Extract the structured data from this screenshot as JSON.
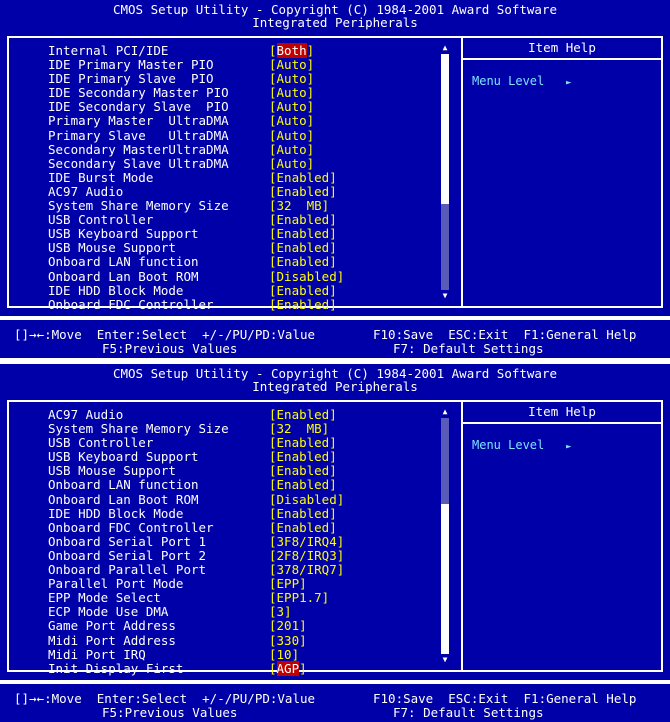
{
  "screens": [
    {
      "title_line1": "CMOS Setup Utility - Copyright (C) 1984-2001 Award Software",
      "title_line2": "Integrated Peripherals",
      "help_title": "Item Help",
      "menu_level": "Menu Level",
      "rows": [
        {
          "label": "Internal PCI/IDE",
          "value": "[Both]",
          "selected": true
        },
        {
          "label": "IDE Primary Master PIO",
          "value": "[Auto]"
        },
        {
          "label": "IDE Primary Slave  PIO",
          "value": "[Auto]"
        },
        {
          "label": "IDE Secondary Master PIO",
          "value": "[Auto]"
        },
        {
          "label": "IDE Secondary Slave  PIO",
          "value": "[Auto]"
        },
        {
          "label": "Primary Master  UltraDMA",
          "value": "[Auto]"
        },
        {
          "label": "Primary Slave   UltraDMA",
          "value": "[Auto]"
        },
        {
          "label": "Secondary MasterUltraDMA",
          "value": "[Auto]"
        },
        {
          "label": "Secondary Slave UltraDMA",
          "value": "[Auto]"
        },
        {
          "label": "IDE Burst Mode",
          "value": "[Enabled]"
        },
        {
          "label": "AC97 Audio",
          "value": "[Enabled]"
        },
        {
          "label": "System Share Memory Size",
          "value": "[32  MB]"
        },
        {
          "label": "USB Controller",
          "value": "[Enabled]"
        },
        {
          "label": "USB Keyboard Support",
          "value": "[Enabled]"
        },
        {
          "label": "USB Mouse Support",
          "value": "[Enabled]"
        },
        {
          "label": "Onboard LAN function",
          "value": "[Enabled]"
        },
        {
          "label": "Onboard Lan Boot ROM",
          "value": "[Disabled]"
        },
        {
          "label": "IDE HDD Block Mode",
          "value": "[Enabled]"
        },
        {
          "label": "Onboard FDC Controller",
          "value": "[Enabled]"
        }
      ],
      "scroll_position": 0.0,
      "status_line1_left": "[]→←:Move  Enter:Select  +/-/PU/PD:Value",
      "status_line1_mid": "F10:Save  ESC:Exit  F1:General Help",
      "status_line2_left": "F5:Previous Values",
      "status_line2_mid": "F7: Default Settings"
    },
    {
      "title_line1": "CMOS Setup Utility - Copyright (C) 1984-2001 Award Software",
      "title_line2": "Integrated Peripherals",
      "help_title": "Item Help",
      "menu_level": "Menu Level",
      "rows": [
        {
          "label": "AC97 Audio",
          "value": "[Enabled]"
        },
        {
          "label": "System Share Memory Size",
          "value": "[32  MB]"
        },
        {
          "label": "USB Controller",
          "value": "[Enabled]"
        },
        {
          "label": "USB Keyboard Support",
          "value": "[Enabled]"
        },
        {
          "label": "USB Mouse Support",
          "value": "[Enabled]"
        },
        {
          "label": "Onboard LAN function",
          "value": "[Enabled]"
        },
        {
          "label": "Onboard Lan Boot ROM",
          "value": "[Disabled]"
        },
        {
          "label": "IDE HDD Block Mode",
          "value": "[Enabled]"
        },
        {
          "label": "Onboard FDC Controller",
          "value": "[Enabled]"
        },
        {
          "label": "Onboard Serial Port 1",
          "value": "[3F8/IRQ4]"
        },
        {
          "label": "Onboard Serial Port 2",
          "value": "[2F8/IRQ3]"
        },
        {
          "label": "Onboard Parallel Port",
          "value": "[378/IRQ7]"
        },
        {
          "label": "Parallel Port Mode",
          "value": "[EPP]"
        },
        {
          "label": "EPP Mode Select",
          "value": "[EPP1.7]"
        },
        {
          "label": "ECP Mode Use DMA",
          "value": "[3]"
        },
        {
          "label": "Game Port Address",
          "value": "[201]"
        },
        {
          "label": "Midi Port Address",
          "value": "[330]"
        },
        {
          "label": "Midi Port IRQ",
          "value": "[10]"
        },
        {
          "label": "Init Display First",
          "value": "[AGP]",
          "selected": true
        }
      ],
      "scroll_position": 1.0,
      "status_line1_left": "[]→←:Move  Enter:Select  +/-/PU/PD:Value",
      "status_line1_mid": "F10:Save  ESC:Exit  F1:General Help",
      "status_line2_left": "F5:Previous Values",
      "status_line2_mid": "F7: Default Settings"
    }
  ],
  "colors": {
    "background": "#0000a8",
    "label": "#ffffff",
    "value": "#ffff00",
    "highlight": "#c00000",
    "menu_level": "#7ee3ff"
  },
  "icons": {
    "menu_level_arrow": "triangle-right-icon",
    "scroll_up": "triangle-up-icon",
    "scroll_down": "triangle-down-icon"
  }
}
